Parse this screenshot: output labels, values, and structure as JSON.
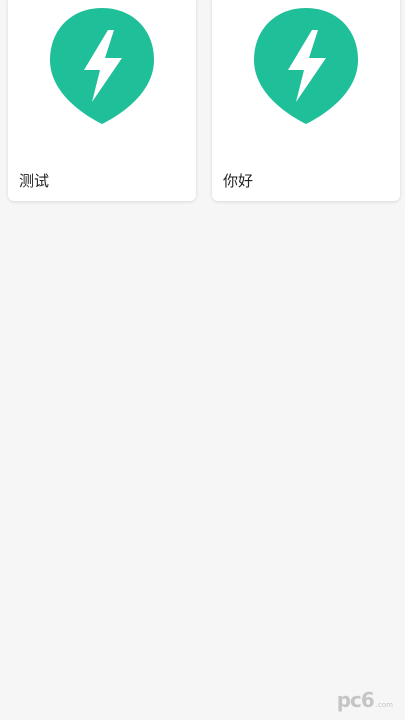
{
  "cards": [
    {
      "label": "测试",
      "icon": "lightning-pin-icon",
      "icon_color": "#1fbf99"
    },
    {
      "label": "你好",
      "icon": "lightning-pin-icon",
      "icon_color": "#1fbf99"
    }
  ],
  "watermark": {
    "main": "pc6",
    "sub": ".com"
  },
  "colors": {
    "background": "#f6f6f6",
    "card": "#ffffff",
    "accent": "#1fbf99"
  }
}
